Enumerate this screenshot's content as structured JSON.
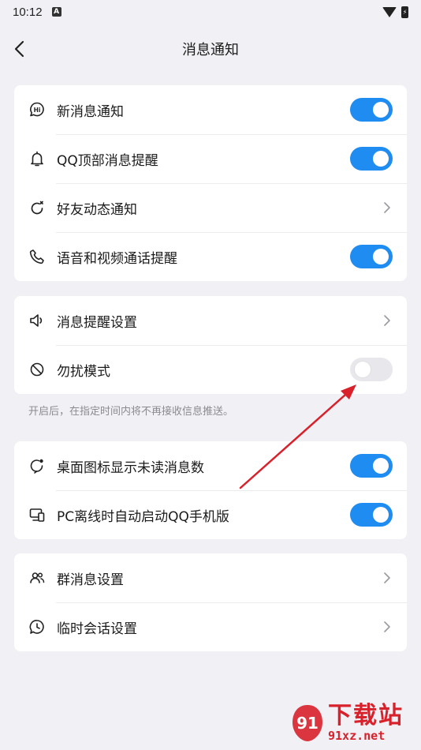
{
  "status": {
    "time": "10:12",
    "app_badge": "A"
  },
  "header": {
    "title": "消息通知"
  },
  "groups": [
    {
      "rows": [
        {
          "label": "新消息通知",
          "icon": "hi-bubble-icon",
          "control": "toggle",
          "on": true
        },
        {
          "label": "QQ顶部消息提醒",
          "icon": "bell-icon",
          "control": "toggle",
          "on": true
        },
        {
          "label": "好友动态通知",
          "icon": "refresh-star-icon",
          "control": "chevron"
        },
        {
          "label": "语音和视频通话提醒",
          "icon": "phone-icon",
          "control": "toggle",
          "on": true
        }
      ]
    },
    {
      "rows": [
        {
          "label": "消息提醒设置",
          "icon": "speaker-icon",
          "control": "chevron"
        },
        {
          "label": "勿扰模式",
          "icon": "no-disturb-icon",
          "control": "toggle",
          "on": false
        }
      ]
    },
    {
      "rows": [
        {
          "label": "桌面图标显示未读消息数",
          "icon": "badge-bubble-icon",
          "control": "toggle",
          "on": true
        },
        {
          "label": "PC离线时自动启动QQ手机版",
          "icon": "pc-phone-icon",
          "control": "toggle",
          "on": true
        }
      ]
    },
    {
      "rows": [
        {
          "label": "群消息设置",
          "icon": "group-icon",
          "control": "chevron"
        },
        {
          "label": "临时会话设置",
          "icon": "clock-bubble-icon",
          "control": "chevron"
        }
      ]
    }
  ],
  "hint": "开启后，在指定时间内将不再接收信息推送。",
  "annotation": {
    "arrow_color": "#d8212b"
  },
  "watermark": {
    "main": "下载站",
    "sub": "91xz.net",
    "logo_text": "91"
  },
  "colors": {
    "accent": "#1e8cf0",
    "background": "#f1f1f5"
  }
}
